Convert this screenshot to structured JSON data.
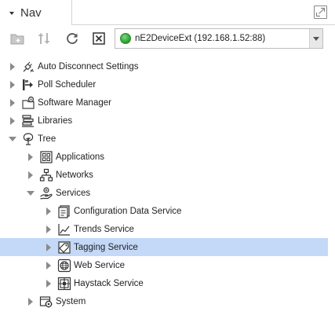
{
  "header": {
    "tab_title": "Nav"
  },
  "toolbar": {
    "station_label": "nE2DeviceExt (192.168.1.52:88)",
    "station_status_color": "#37a937"
  },
  "tree": {
    "auto_disconnect": "Auto Disconnect Settings",
    "poll_scheduler": "Poll Scheduler",
    "software_manager": "Software Manager",
    "libraries": "Libraries",
    "tree": "Tree",
    "applications": "Applications",
    "networks": "Networks",
    "services": "Services",
    "configuration_data_service": "Configuration Data Service",
    "trends_service": "Trends Service",
    "tagging_service": "Tagging Service",
    "web_service": "Web Service",
    "haystack_service": "Haystack Service",
    "system": "System"
  },
  "colors": {
    "selection": "#c4d8f7",
    "toggle": "#8a8a8a"
  }
}
